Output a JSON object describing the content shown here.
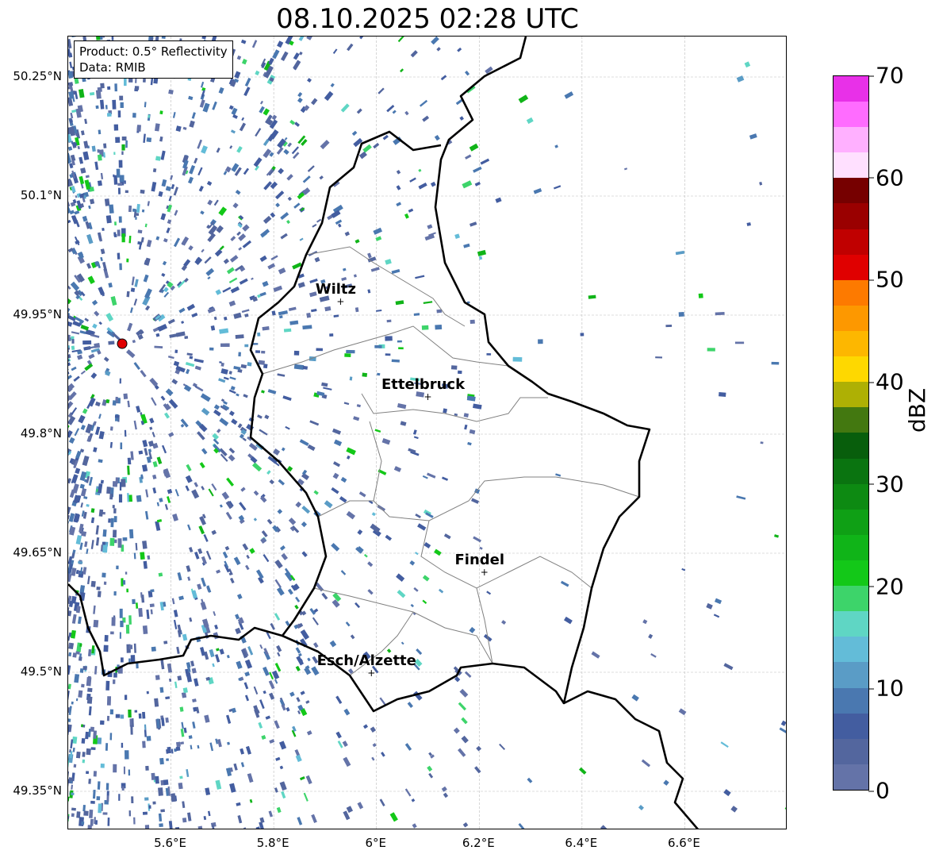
{
  "title": "08.10.2025 02:28 UTC",
  "info": {
    "product": "Product: 0.5° Reflectivity",
    "data": "Data: RMIB"
  },
  "axes": {
    "lat_ticks": [
      {
        "value": 50.25,
        "label": "50.25°N"
      },
      {
        "value": 50.1,
        "label": "50.1°N"
      },
      {
        "value": 49.95,
        "label": "49.95°N"
      },
      {
        "value": 49.8,
        "label": "49.8°N"
      },
      {
        "value": 49.65,
        "label": "49.65°N"
      },
      {
        "value": 49.5,
        "label": "49.5°N"
      },
      {
        "value": 49.35,
        "label": "49.35°N"
      }
    ],
    "lon_ticks": [
      {
        "value": 5.6,
        "label": "5.6°E"
      },
      {
        "value": 5.8,
        "label": "5.8°E"
      },
      {
        "value": 6.0,
        "label": "6°E"
      },
      {
        "value": 6.2,
        "label": "6.2°E"
      },
      {
        "value": 6.4,
        "label": "6.4°E"
      },
      {
        "value": 6.6,
        "label": "6.6°E"
      }
    ],
    "lon_range": [
      5.4,
      6.8
    ],
    "lat_range": [
      49.301,
      50.301
    ]
  },
  "cities": [
    {
      "name": "Wiltz",
      "lon": 5.93,
      "lat": 49.967
    },
    {
      "name": "Ettelbruck",
      "lon": 6.1,
      "lat": 49.847
    },
    {
      "name": "Findel",
      "lon": 6.21,
      "lat": 49.626
    },
    {
      "name": "Esch/Alzette",
      "lon": 5.99,
      "lat": 49.499
    }
  ],
  "radar_site": {
    "lon": 5.505,
    "lat": 49.914,
    "color": "#e00000"
  },
  "colorbar": {
    "label": "dBZ",
    "min": 0,
    "max": 70,
    "ticks": [
      {
        "value": 0,
        "label": "0"
      },
      {
        "value": 10,
        "label": "10"
      },
      {
        "value": 20,
        "label": "20"
      },
      {
        "value": 30,
        "label": "30"
      },
      {
        "value": 40,
        "label": "40"
      },
      {
        "value": 50,
        "label": "50"
      },
      {
        "value": 60,
        "label": "60"
      },
      {
        "value": 70,
        "label": "70"
      }
    ],
    "colors": [
      "#6473a8",
      "#53669e",
      "#435da0",
      "#4a78b0",
      "#5a9cc6",
      "#63bcd8",
      "#5fd6c4",
      "#3dd46a",
      "#13c818",
      "#10b418",
      "#0fa015",
      "#0d8a12",
      "#0a7410",
      "#085e0c",
      "#437810",
      "#aeb004",
      "#fed800",
      "#fdb700",
      "#fd9800",
      "#fd7a00",
      "#e00000",
      "#c00000",
      "#9a0000",
      "#760000",
      "#ffe0ff",
      "#ffb0ff",
      "#ff6cff",
      "#e830e8"
    ]
  }
}
